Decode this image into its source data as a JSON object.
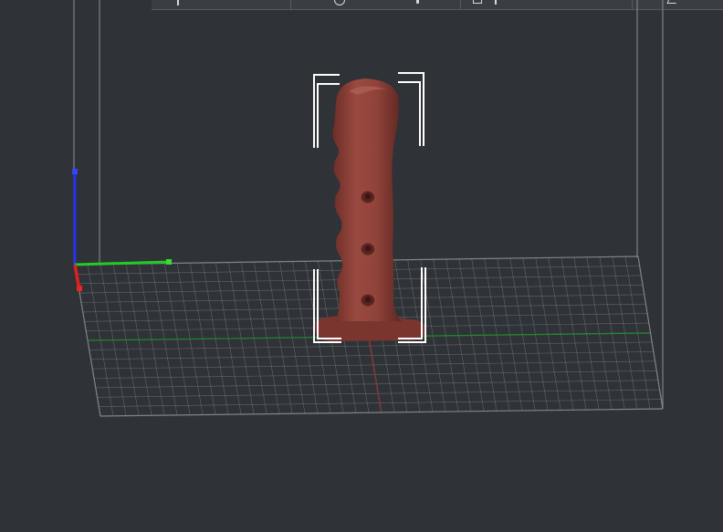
{
  "app": {
    "view": "3D Preview",
    "colors": {
      "background": "#2f3237",
      "grid_line": "#8a8d92",
      "frame_line": "#7e8186",
      "model_fill": "#8a3d35",
      "model_shade": "#6f2e28",
      "model_highlight": "#a8554b",
      "axis_x": "#e02020",
      "axis_y": "#22cc22",
      "axis_z": "#2233ee",
      "selection_bracket": "#ffffff"
    }
  },
  "toolbar": {
    "buttons": [
      {
        "name": "move-tool",
        "icon": "move-icon"
      },
      {
        "name": "rotate-tool",
        "icon": "rotate-icon"
      },
      {
        "name": "scale-tool",
        "icon": "scale-icon"
      },
      {
        "name": "edit-tool",
        "icon": "pencil-icon"
      }
    ]
  },
  "scene": {
    "object": "handle-model",
    "selected": true,
    "holes": 3
  }
}
